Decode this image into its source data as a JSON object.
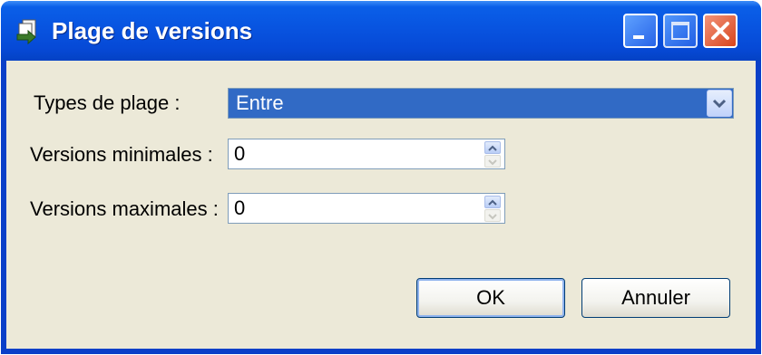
{
  "window": {
    "title": "Plage de versions"
  },
  "form": {
    "range_type": {
      "label": "Types de plage :",
      "value": "Entre"
    },
    "min_versions": {
      "label": "Versions minimales :",
      "value": "0"
    },
    "max_versions": {
      "label": "Versions maximales :",
      "value": "0"
    }
  },
  "buttons": {
    "ok": "OK",
    "cancel": "Annuler"
  },
  "icons": {
    "title": "app-icon",
    "minimize": "minimize-icon",
    "maximize": "maximize-icon",
    "close": "close-icon",
    "dropdown": "chevron-down-icon",
    "spin_up": "spin-up-icon",
    "spin_down": "spin-down-icon"
  },
  "colors": {
    "titlebar": "#0854e0",
    "client_bg": "#ece9d8",
    "selection": "#316ac5",
    "close_button": "#d8451d"
  }
}
